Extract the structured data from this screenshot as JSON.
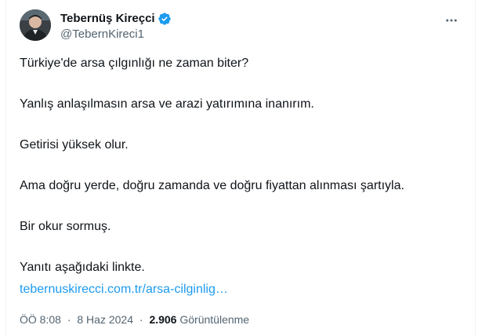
{
  "author": {
    "display_name": "Tebernüş Kireçci",
    "handle": "@TebernKireci1",
    "verified": true,
    "verified_color": "#1d9bf0"
  },
  "menu": {
    "icon": "more-horizontal-icon"
  },
  "tweet": {
    "paragraphs": [
      "Türkiye'de arsa çılgınlığı ne zaman biter?",
      "Yanlış anlaşılmasın arsa ve arazi yatırımına inanırım.",
      "Getirisi yüksek olur.",
      "Ama doğru yerde, doğru zamanda ve doğru fiyattan alınması şartıyla.",
      "Bir okur sormuş.",
      "Yanıtı aşağıdaki linkte."
    ],
    "link_text": "tebernuskirecci.com.tr/arsa-cilginlig…",
    "link_color": "#1d9bf0"
  },
  "meta": {
    "time": "ÖÖ 8:08",
    "separator": "·",
    "date": "8 Haz 2024",
    "views_count": "2.906",
    "views_label": "Görüntülenme"
  }
}
